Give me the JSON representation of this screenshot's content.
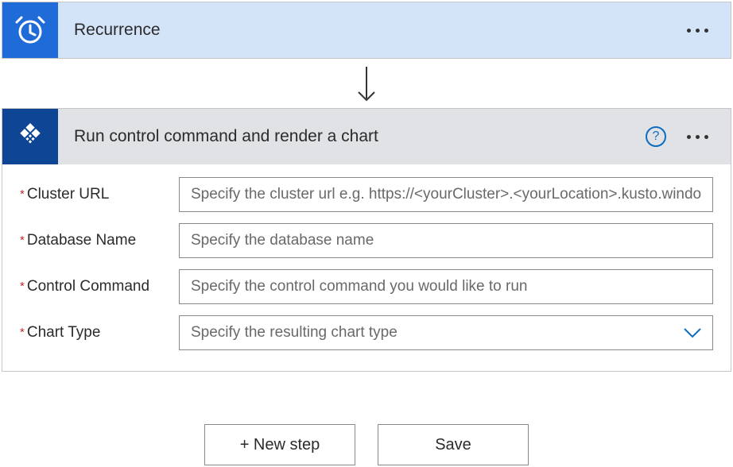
{
  "recurrence": {
    "title": "Recurrence"
  },
  "control": {
    "title": "Run control command and render a chart",
    "fields": {
      "clusterUrl": {
        "label": "Cluster URL",
        "placeholder": "Specify the cluster url e.g. https://<yourCluster>.<yourLocation>.kusto.window"
      },
      "databaseName": {
        "label": "Database Name",
        "placeholder": "Specify the database name"
      },
      "controlCommand": {
        "label": "Control Command",
        "placeholder": "Specify the control command you would like to run"
      },
      "chartType": {
        "label": "Chart Type",
        "placeholder": "Specify the resulting chart type"
      }
    }
  },
  "buttons": {
    "newStep": "+ New step",
    "save": "Save"
  },
  "helpChar": "?"
}
